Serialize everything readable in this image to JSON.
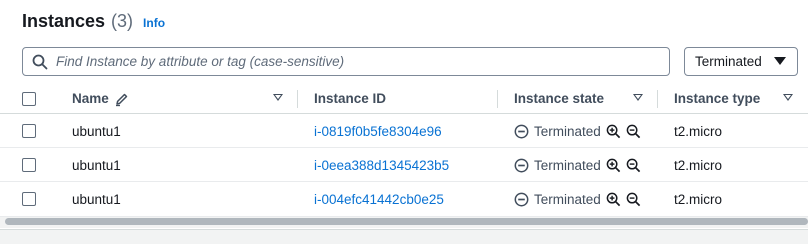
{
  "header": {
    "title": "Instances",
    "count": "(3)",
    "info_link": "Info"
  },
  "search": {
    "placeholder": "Find Instance by attribute or tag (case-sensitive)"
  },
  "state_filter": {
    "selected": "Terminated"
  },
  "table": {
    "columns": [
      "Name",
      "Instance ID",
      "Instance state",
      "Instance type"
    ],
    "rows": [
      {
        "name": "ubuntu1",
        "instance_id": "i-0819f0b5fe8304e96",
        "state": "Terminated",
        "type": "t2.micro"
      },
      {
        "name": "ubuntu1",
        "instance_id": "i-0eea388d1345423b5",
        "state": "Terminated",
        "type": "t2.micro"
      },
      {
        "name": "ubuntu1",
        "instance_id": "i-004efc41442cb0e25",
        "state": "Terminated",
        "type": "t2.micro"
      }
    ]
  },
  "colors": {
    "link": "#0972d3",
    "text": "#16191f",
    "muted": "#5f6b7a"
  },
  "icons": [
    "search-icon",
    "pencil-icon",
    "filter-caret-icon",
    "terminated-status-icon",
    "zoom-in-icon",
    "zoom-out-icon",
    "dropdown-caret-icon"
  ]
}
